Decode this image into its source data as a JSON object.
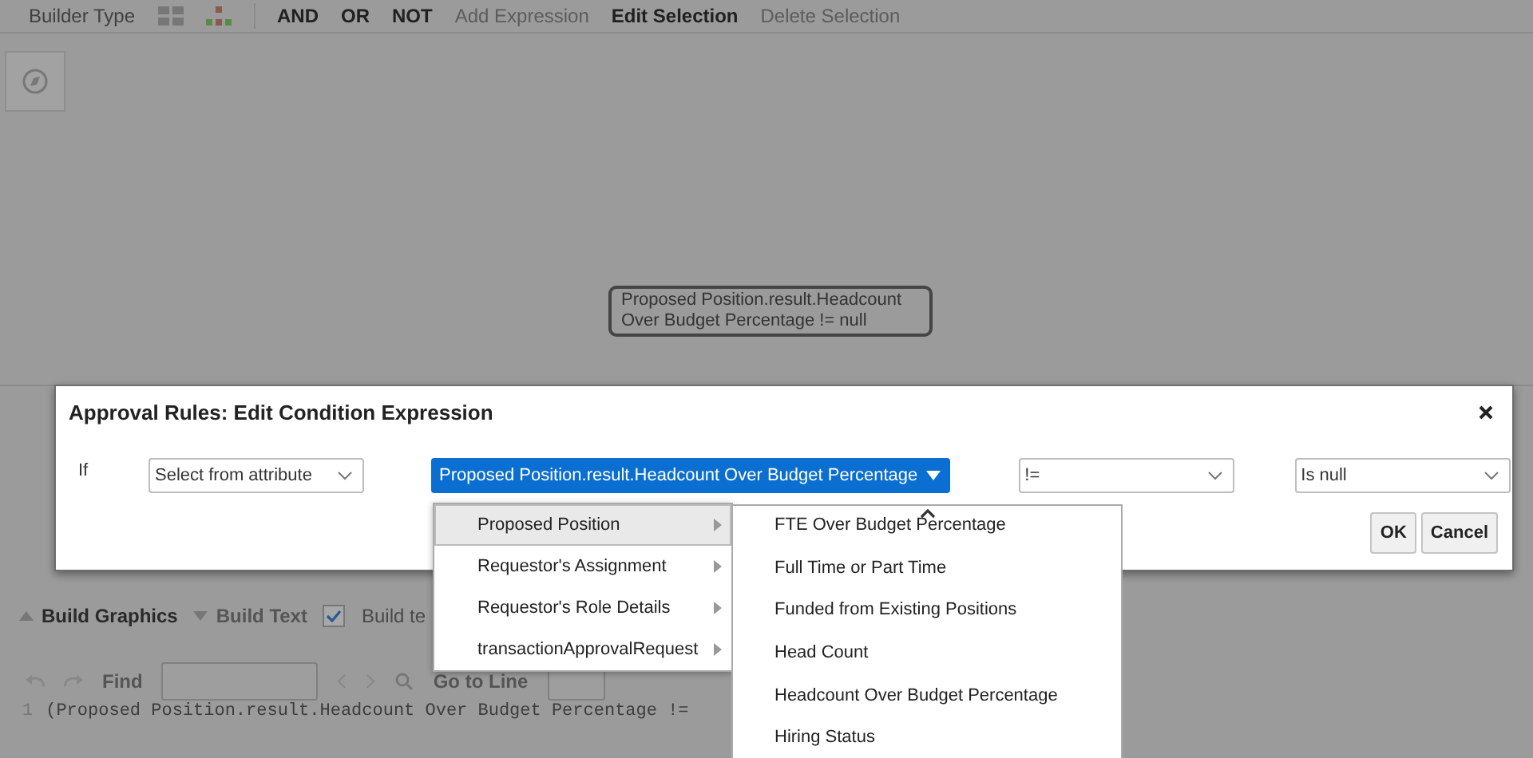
{
  "toolbar": {
    "label": "Builder Type",
    "items": [
      {
        "label": "AND",
        "disabled": false
      },
      {
        "label": "OR",
        "disabled": false
      },
      {
        "label": "NOT",
        "disabled": false
      },
      {
        "label": "Add Expression",
        "disabled": true
      },
      {
        "label": "Edit Selection",
        "disabled": false
      },
      {
        "label": "Delete Selection",
        "disabled": true
      }
    ]
  },
  "canvas": {
    "node": "Proposed Position.result.Headcount Over Budget Percentage != null"
  },
  "dialog": {
    "title": "Approval Rules: Edit Condition Expression",
    "if_label": "If",
    "fields": [
      {
        "kind": "select",
        "value": "Select from attribute"
      },
      {
        "kind": "menu_button",
        "value": "Proposed Position.result.Headcount Over Budget Percentage"
      },
      {
        "kind": "select",
        "value": "!="
      },
      {
        "kind": "select",
        "value": "Is null"
      }
    ],
    "buttons": [
      "OK",
      "Cancel"
    ]
  },
  "build_bar": {
    "tabs": [
      {
        "label": "Build Graphics",
        "selected": true
      },
      {
        "label": "Build Text",
        "selected": false
      }
    ],
    "checkbox": {
      "label": "Build te",
      "checked": true
    }
  },
  "editor": {
    "find_label": "Find",
    "goto_label": "Go to Line",
    "lines": [
      {
        "number": "1",
        "text": "(Proposed Position.result.Headcount Over Budget Percentage !="
      }
    ]
  },
  "attribute_menu": {
    "items": [
      {
        "label": "Proposed Position",
        "selected": true
      },
      {
        "label": "Requestor's Assignment",
        "selected": false
      },
      {
        "label": "Requestor's Role Details",
        "selected": false
      },
      {
        "label": "transactionApprovalRequest",
        "selected": false
      }
    ],
    "submenu": {
      "items": [
        "FTE Over Budget Percentage",
        "Full Time or Part Time",
        "Funded from Existing Positions",
        "Head Count",
        "Headcount Over Budget Percentage",
        "Hiring Status"
      ]
    }
  }
}
